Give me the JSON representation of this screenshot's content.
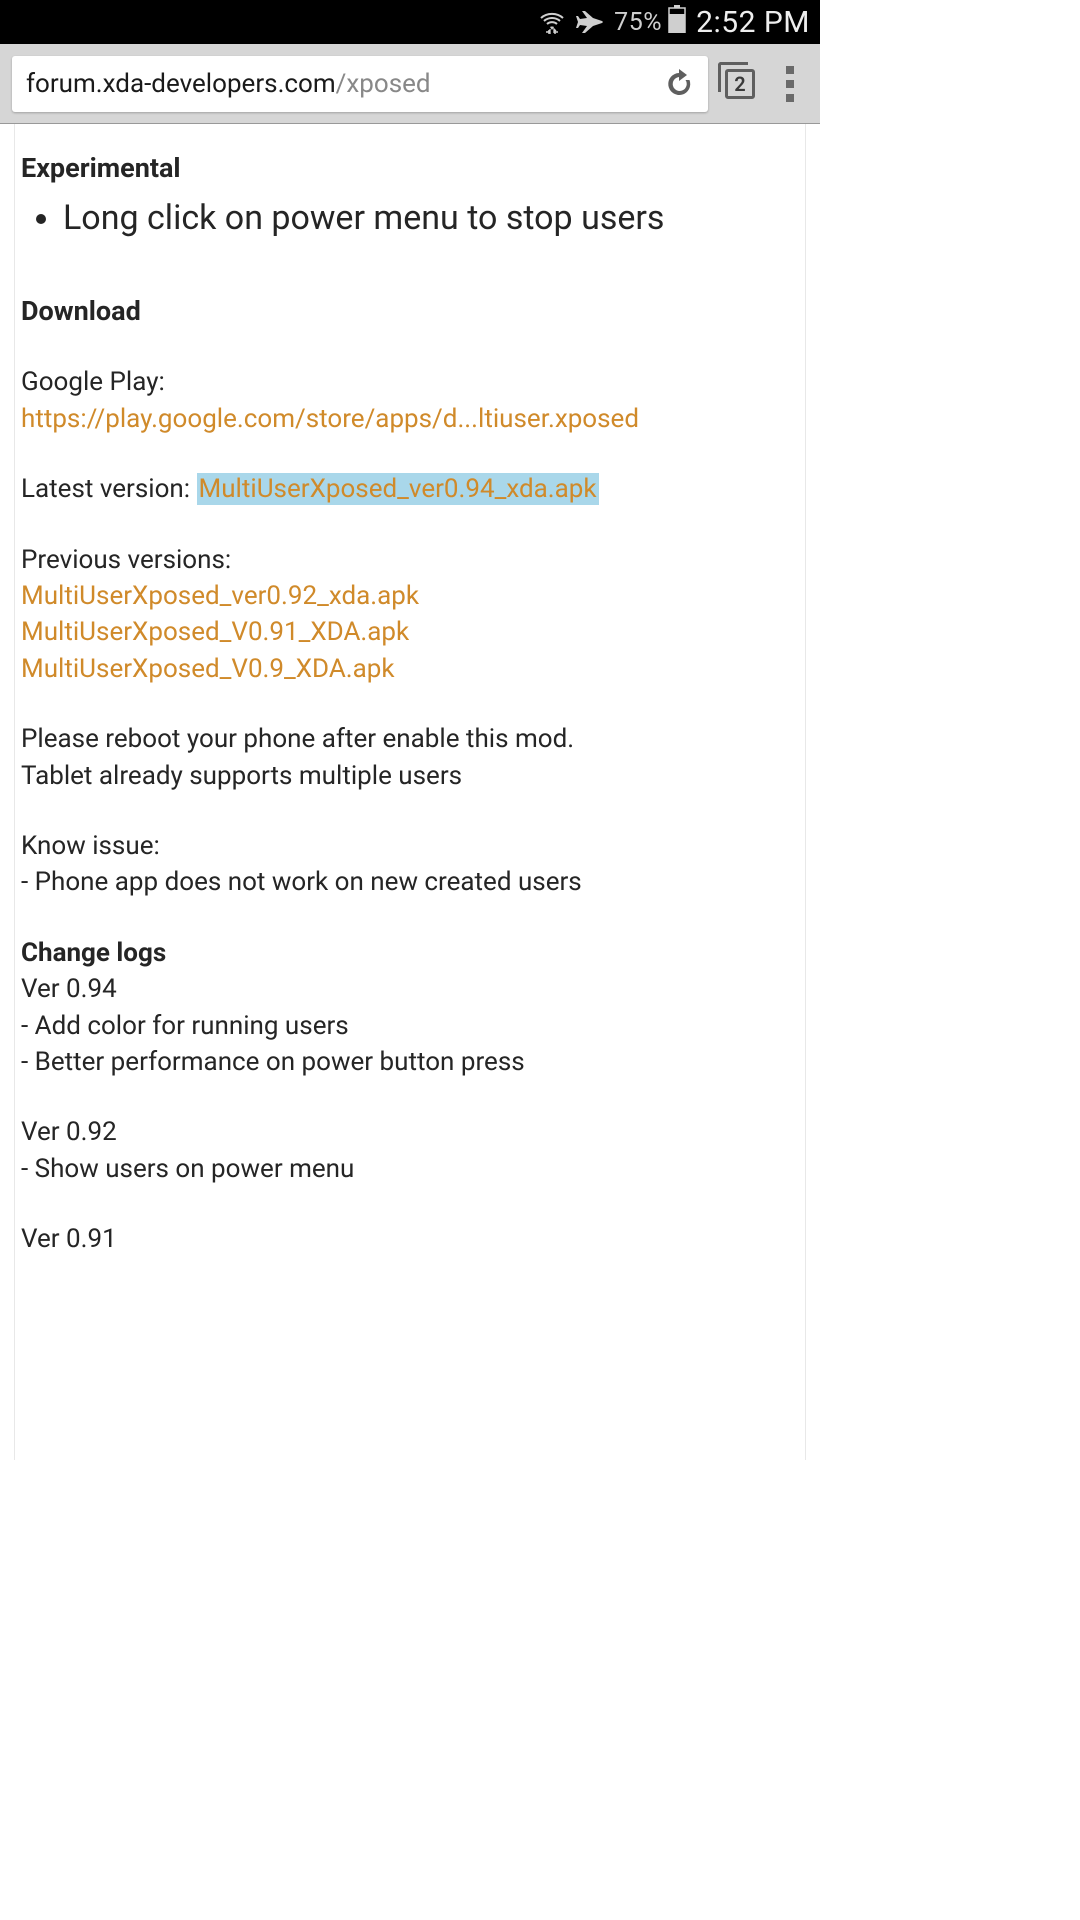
{
  "status": {
    "battery_pct": "75%",
    "time": "2:52 PM"
  },
  "toolbar": {
    "url_host": "forum.xda-developers.com",
    "url_path": "/xposed",
    "tab_count": "2"
  },
  "page": {
    "experimental_heading": "Experimental",
    "experimental_item": "Long click on power menu to stop users",
    "download_heading": "Download",
    "google_play_label": "Google Play:",
    "google_play_link": "https://play.google.com/store/apps/d...ltiuser.xposed",
    "latest_label": "Latest version: ",
    "latest_link": "MultiUserXposed_ver0.94_xda.apk",
    "previous_label": "Previous versions:",
    "previous_link_1": "MultiUserXposed_ver0.92_xda.apk",
    "previous_link_2": "MultiUserXposed_V0.91_XDA.apk",
    "previous_link_3": "MultiUserXposed_V0.9_XDA.apk",
    "reboot_line1": "Please reboot your phone after enable this mod.",
    "reboot_line2": "Tablet already supports multiple users",
    "known_issue_label": "Know issue:",
    "known_issue_1": "- Phone app does not work on new created users",
    "changelogs_heading": "Change logs",
    "cl_094_label": "Ver 0.94",
    "cl_094_1": "- Add color for running users",
    "cl_094_2": "- Better performance on power button press",
    "cl_092_label": "Ver 0.92",
    "cl_092_1": "- Show users on power menu",
    "cl_091_label": "Ver 0.91"
  }
}
